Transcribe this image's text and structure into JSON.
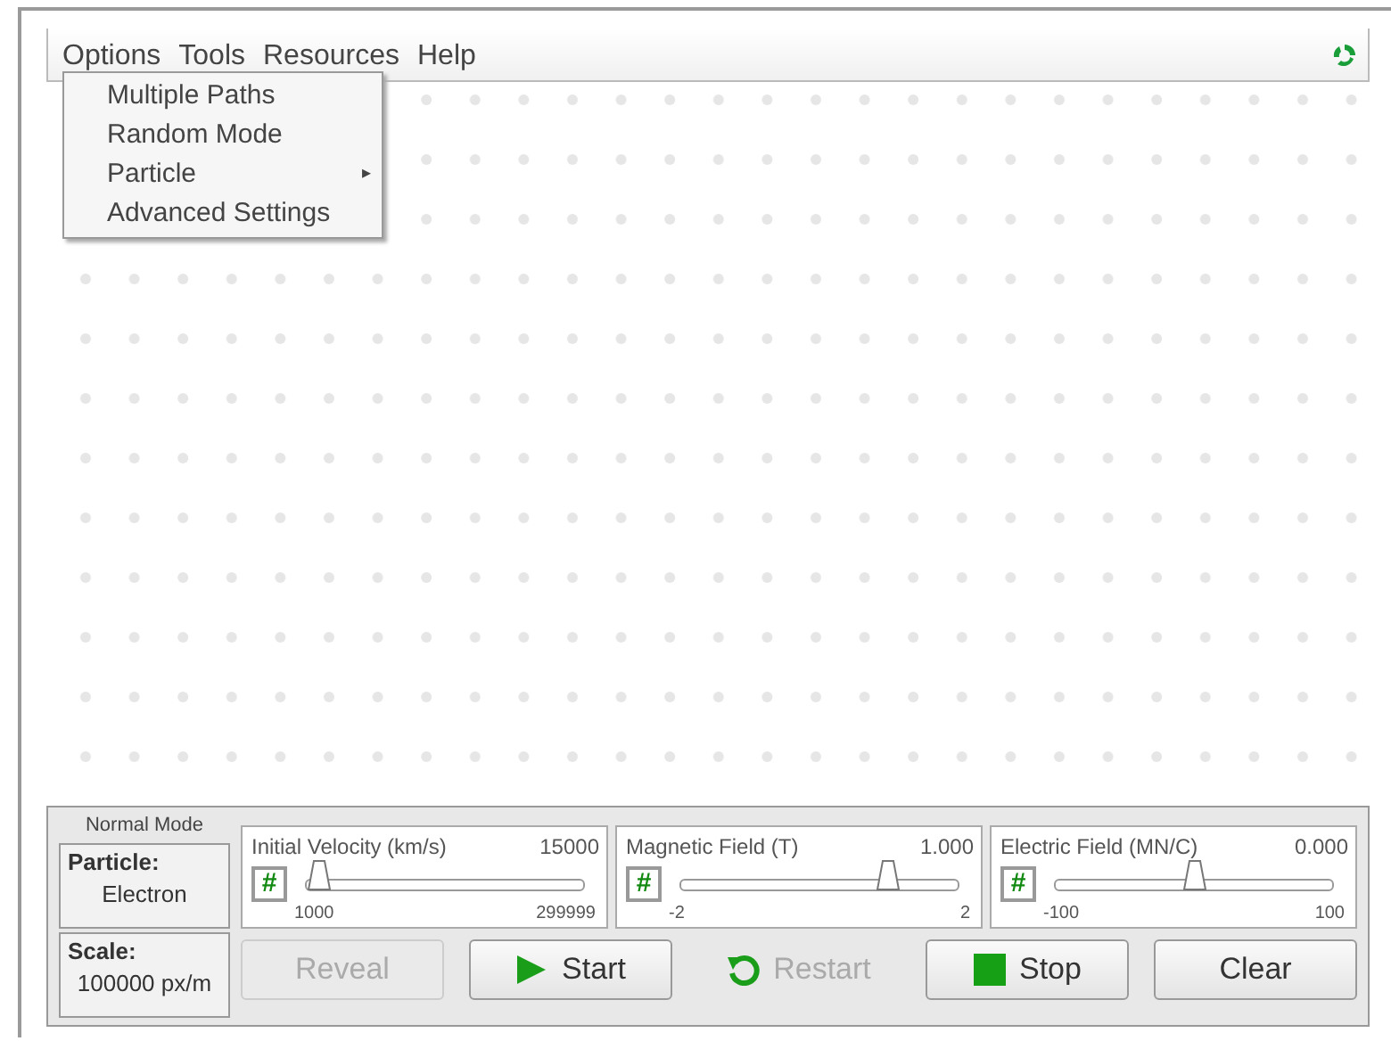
{
  "menu_bar": {
    "items": [
      {
        "label": "Options"
      },
      {
        "label": "Tools"
      },
      {
        "label": "Resources"
      },
      {
        "label": "Help"
      }
    ]
  },
  "options_menu": {
    "items": [
      {
        "label": "Multiple Paths"
      },
      {
        "label": "Random Mode"
      },
      {
        "label": "Particle",
        "arrow": "▸"
      },
      {
        "label": "Advanced Settings"
      }
    ]
  },
  "control_panel": {
    "mode": "Normal Mode",
    "particle": {
      "label": "Particle:",
      "value": "Electron"
    },
    "scale": {
      "label": "Scale:",
      "value": "100000 px/m"
    },
    "sliders": [
      {
        "label": "Initial Velocity (km/s)",
        "reading": "15000",
        "key": "#",
        "min": "1000",
        "max": "299999",
        "level": 0.047
      },
      {
        "label": "Magnetic Field (T)",
        "reading": "1.000",
        "key": "#",
        "min": "-2",
        "max": "2",
        "level": 0.75
      },
      {
        "label": "Electric Field (MN/C)",
        "reading": "0.000",
        "key": "#",
        "min": "-100",
        "max": "100",
        "level": 0.5
      }
    ],
    "buttons": [
      {
        "label": "Reveal",
        "kind": "plain",
        "disabled": true,
        "framed": true
      },
      {
        "label": "Start",
        "kind": "play",
        "disabled": false,
        "framed": true
      },
      {
        "label": "Restart",
        "kind": "restart",
        "disabled": true,
        "framed": false
      },
      {
        "label": "Stop",
        "kind": "stop",
        "disabled": false,
        "framed": true
      },
      {
        "label": "Clear",
        "kind": "plain",
        "disabled": false,
        "framed": true
      }
    ]
  }
}
